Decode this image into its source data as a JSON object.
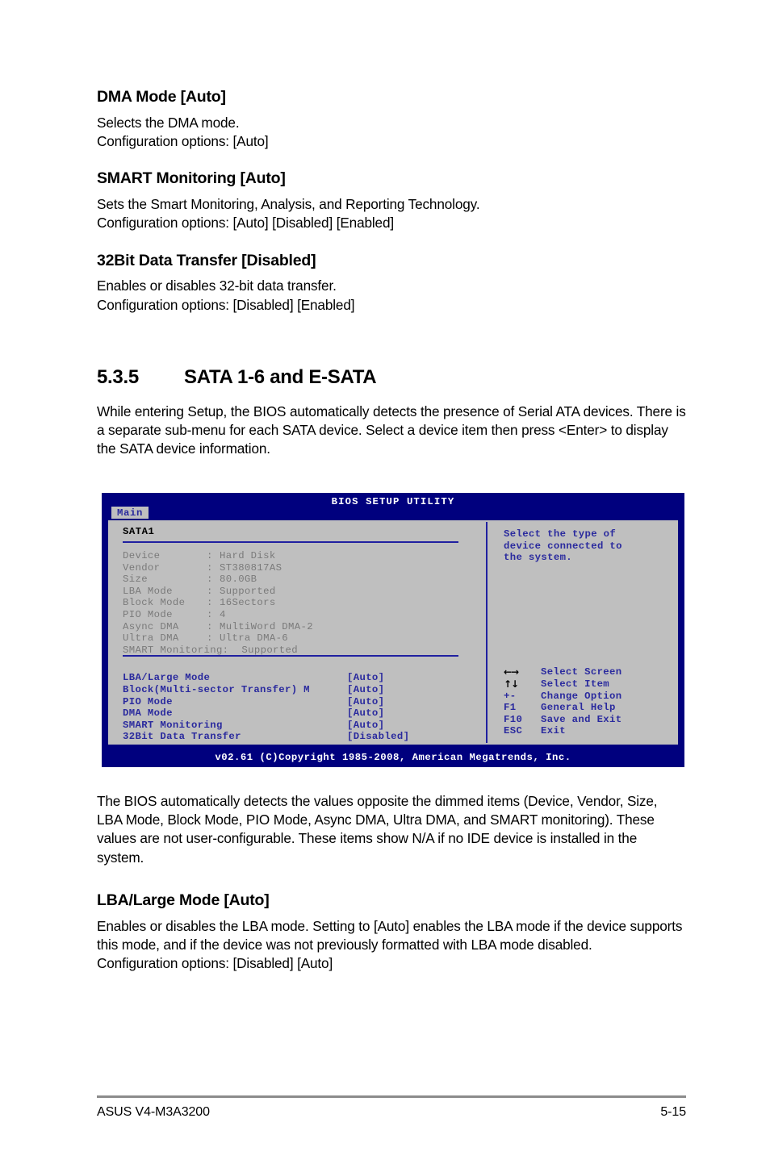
{
  "sections": [
    {
      "heading": "DMA Mode [Auto]",
      "lines": [
        "Selects the DMA mode.",
        "Configuration options: [Auto]"
      ]
    },
    {
      "heading": "SMART Monitoring [Auto]",
      "lines": [
        "Sets the Smart Monitoring, Analysis, and Reporting Technology.",
        "Configuration options: [Auto] [Disabled] [Enabled]"
      ]
    },
    {
      "heading": "32Bit Data Transfer [Disabled]",
      "lines": [
        "Enables or disables 32-bit data transfer.",
        "Configuration options: [Disabled] [Enabled]"
      ]
    }
  ],
  "section_header": {
    "number": "5.3.5",
    "title": "SATA 1-6 and E-SATA",
    "intro": "While entering Setup, the BIOS automatically detects the presence of Serial ATA devices. There is a separate sub-menu for each SATA device. Select a device item then press <Enter> to display the SATA device information."
  },
  "bios": {
    "title": "BIOS SETUP UTILITY",
    "tab": "Main",
    "panel_title": "SATA1",
    "info": [
      {
        "key": "Device",
        "sep": ":",
        "value": "Hard Disk"
      },
      {
        "key": "Vendor",
        "sep": ":",
        "value": "ST380817AS"
      },
      {
        "key": "Size",
        "sep": ":",
        "value": "80.0GB"
      },
      {
        "key": "LBA Mode",
        "sep": ":",
        "value": "Supported"
      },
      {
        "key": "Block Mode",
        "sep": ":",
        "value": "16Sectors"
      },
      {
        "key": "PIO Mode",
        "sep": ":",
        "value": "4"
      },
      {
        "key": "Async DMA",
        "sep": ":",
        "value": "MultiWord DMA-2"
      },
      {
        "key": "Ultra DMA",
        "sep": ":",
        "value": "Ultra DMA-6"
      }
    ],
    "smart_line": {
      "key": "SMART Monitoring:",
      "value": "Supported"
    },
    "settings": [
      {
        "label": "LBA/Large Mode",
        "value": "[Auto]"
      },
      {
        "label": "Block(Multi-sector Transfer) M",
        "value": "[Auto]"
      },
      {
        "label": "PIO Mode",
        "value": "[Auto]"
      },
      {
        "label": "DMA Mode",
        "value": "[Auto]"
      },
      {
        "label": "SMART Monitoring",
        "value": "[Auto]"
      },
      {
        "label": "32Bit Data Transfer",
        "value": "[Disabled]"
      }
    ],
    "help_text": "Select the type of\ndevice connected to\nthe system.",
    "legend": [
      {
        "key": "←→",
        "icon": "left-right-arrow-icon",
        "label": "Select Screen"
      },
      {
        "key": "↑↓",
        "icon": "up-down-arrow-icon",
        "label": "Select Item"
      },
      {
        "key": "+-",
        "icon": "",
        "label": "Change Option"
      },
      {
        "key": "F1",
        "icon": "",
        "label": "General Help"
      },
      {
        "key": "F10",
        "icon": "",
        "label": "Save and Exit"
      },
      {
        "key": "ESC",
        "icon": "",
        "label": "Exit"
      }
    ],
    "footer": "v02.61 (C)Copyright 1985-2008, American Megatrends, Inc.",
    "colors": {
      "chrome_blue": "#00007e",
      "panel_gray": "#bfbfbf",
      "setting_blue": "#2a2a9e",
      "dimmed_gray": "#7a7a7a"
    }
  },
  "after_bios_note": "The BIOS automatically detects the values opposite the dimmed items (Device, Vendor, Size, LBA Mode, Block Mode, PIO Mode, Async DMA, Ultra DMA, and SMART monitoring). These values are not user-configurable. These items show N/A if no IDE device is installed in the system.",
  "lba_section": {
    "heading": "LBA/Large Mode [Auto]",
    "body": "Enables or disables the LBA mode. Setting to [Auto] enables the LBA mode if the device supports this mode, and if the device was not previously formatted with LBA mode disabled.",
    "options": "Configuration options: [Disabled] [Auto]"
  },
  "page_footer": {
    "left": "ASUS V4-M3A3200",
    "right": "5-15"
  }
}
